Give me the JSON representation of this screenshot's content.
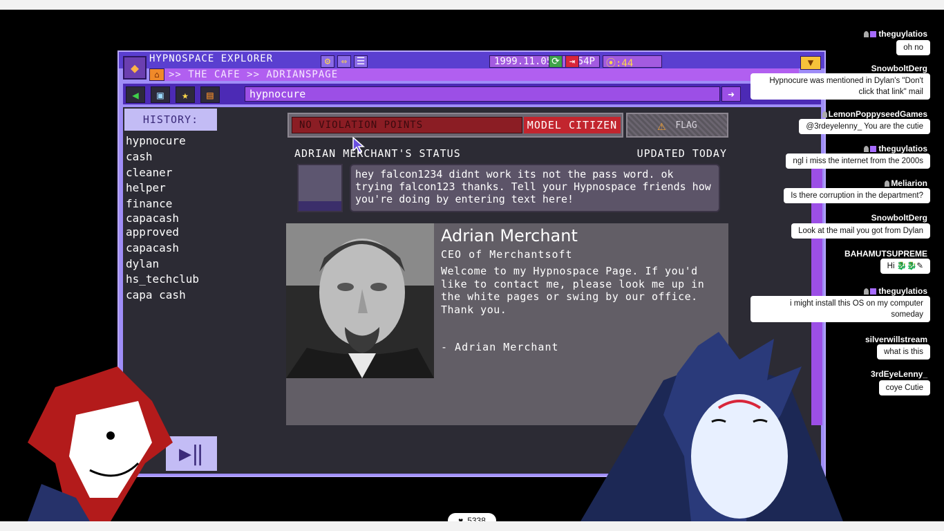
{
  "app": {
    "title": "HYPNOSPACE EXPLORER",
    "date": "1999.11.05",
    "time": "9:54P",
    "coins": "⦿:44"
  },
  "breadcrumb": ">> THE CAFE >> ADRIANSPAGE",
  "address": {
    "value": "hypnocure"
  },
  "history": {
    "header": "HISTORY:",
    "items": [
      "hypnocure",
      "cash",
      "cleaner",
      "helper",
      "finance",
      "capacash",
      "approved",
      "capacash",
      "dylan",
      "hs_techclub",
      "capa cash"
    ]
  },
  "page": {
    "violation_label": "NO VIOLATION POINTS",
    "citizen_label": "MODEL CITIZEN",
    "flag_label": "FLAG",
    "status_heading": "ADRIAN MERCHANT'S STATUS",
    "status_updated": "UPDATED TODAY",
    "status_text": "hey falcon1234 didnt work its not the pass word. ok trying falcon123 thanks. Tell your Hypnospace friends how you're doing by entering text here!",
    "profile_name": "Adrian Merchant",
    "profile_role": "CEO of Merchantsoft",
    "profile_text": "Welcome to my Hypnospace Page. If you'd like to contact me, please look me up in the white pages or swing by our office. Thank you.",
    "profile_sign": "- Adrian Merchant"
  },
  "chat": [
    {
      "user": "theguylatios",
      "text": "oh no"
    },
    {
      "user": "SnowboltDerg",
      "text": "Hypnocure was mentioned in Dylan's \"Don't click that link\" mail"
    },
    {
      "user": "LemonPoppyseedGames",
      "text": "@3rdeyelenny_ You are the cutie"
    },
    {
      "user": "theguylatios",
      "text": "ngl i miss the internet from the 2000s"
    },
    {
      "user": "Meliarion",
      "text": "Is there corruption in the department?"
    },
    {
      "user": "SnowboltDerg",
      "text": "Look at the mail you got from Dylan"
    },
    {
      "user": "BAHAMUTSUPREME",
      "text": "Hi"
    },
    {
      "user": "theguylatios",
      "text": "i might install this OS on my computer someday"
    },
    {
      "user": "silverwillstream",
      "text": "what is this"
    },
    {
      "user": "3rdEyeLenny_",
      "text": "coye Cutie"
    }
  ],
  "likes": "5338",
  "colors": {
    "window": "#9f8df7",
    "page_bg": "#2c2b34",
    "accent_purple": "#9c4fe6",
    "violation_red": "#8b1d24"
  }
}
